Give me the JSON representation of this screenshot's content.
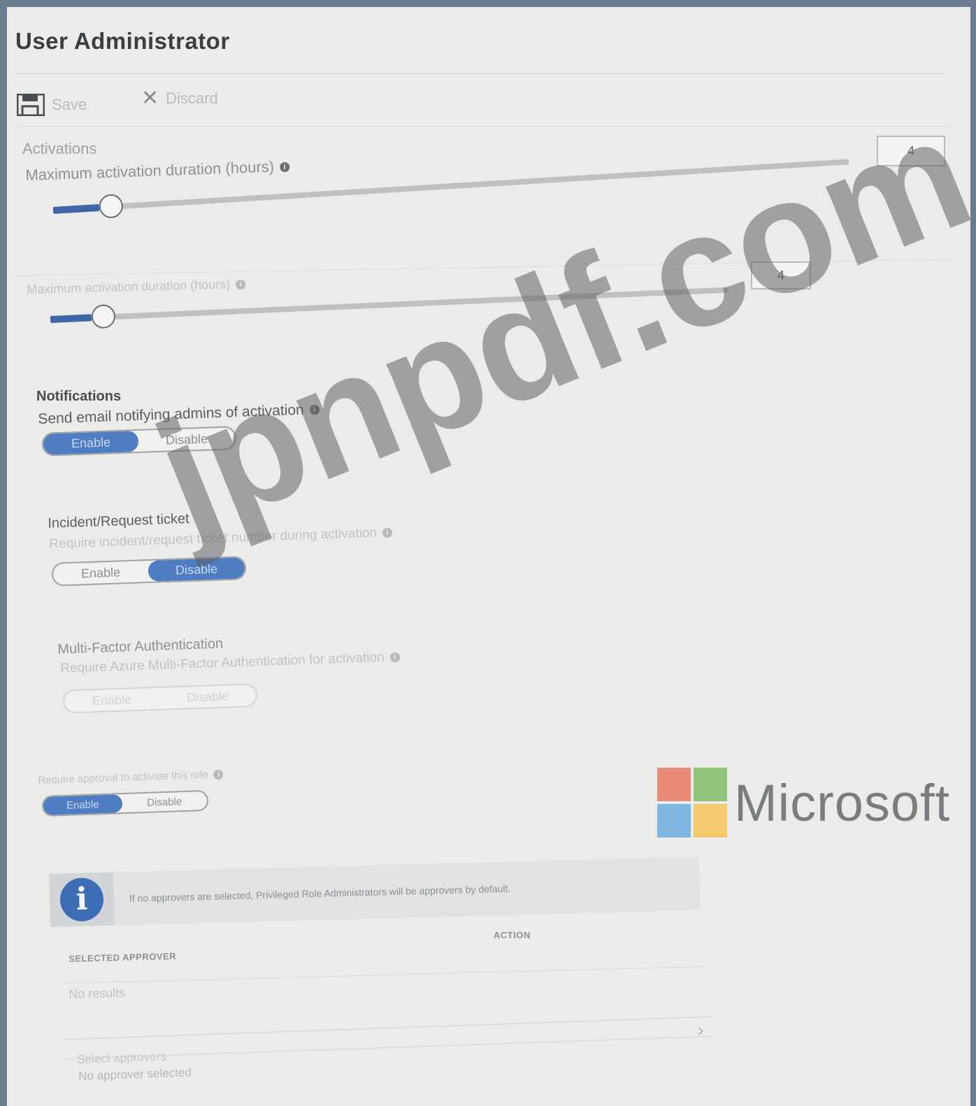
{
  "header": {
    "title": "User Administrator"
  },
  "toolbar": {
    "save_label": "Save",
    "discard_label": "Discard"
  },
  "activations": {
    "section_label": "Activations",
    "primary": {
      "label": "Maximum activation duration (hours)",
      "value": "4",
      "fill_fraction": 0.04
    },
    "secondary": {
      "label": "Maximum activation duration (hours)",
      "value": "4",
      "fill_fraction": 0.04
    }
  },
  "notifications": {
    "heading": "Notifications",
    "label": "Send email notifying admins of activation",
    "enable_label": "Enable",
    "disable_label": "Disable",
    "selected": "Enable"
  },
  "incident": {
    "heading": "Incident/Request ticket",
    "label": "Require incident/request ticket number during activation",
    "enable_label": "Enable",
    "disable_label": "Disable",
    "selected": "Disable"
  },
  "mfa": {
    "heading": "Multi-Factor Authentication",
    "label": "Require Azure Multi-Factor Authentication for activation",
    "enable_label": "Enable",
    "disable_label": "Disable"
  },
  "approval": {
    "label": "Require approval to activate this role",
    "enable_label": "Enable",
    "disable_label": "Disable",
    "selected": "Enable"
  },
  "banner": {
    "text": "If no approvers are selected, Privileged Role Administrators will be approvers by default."
  },
  "approvers_table": {
    "col_selected": "SELECTED APPROVER",
    "col_action": "ACTION",
    "empty": "No results"
  },
  "select_approvers": {
    "label": "Select approvers",
    "value": "No approver selected"
  },
  "overlay": {
    "watermark": "jpnpdf.com",
    "brand": "Microsoft"
  },
  "colors": {
    "accent": "#4f7dc2",
    "ms_red": "#ea8a78",
    "ms_green": "#8fc47a",
    "ms_blue": "#7fb6e2",
    "ms_yellow": "#f5c96e"
  }
}
